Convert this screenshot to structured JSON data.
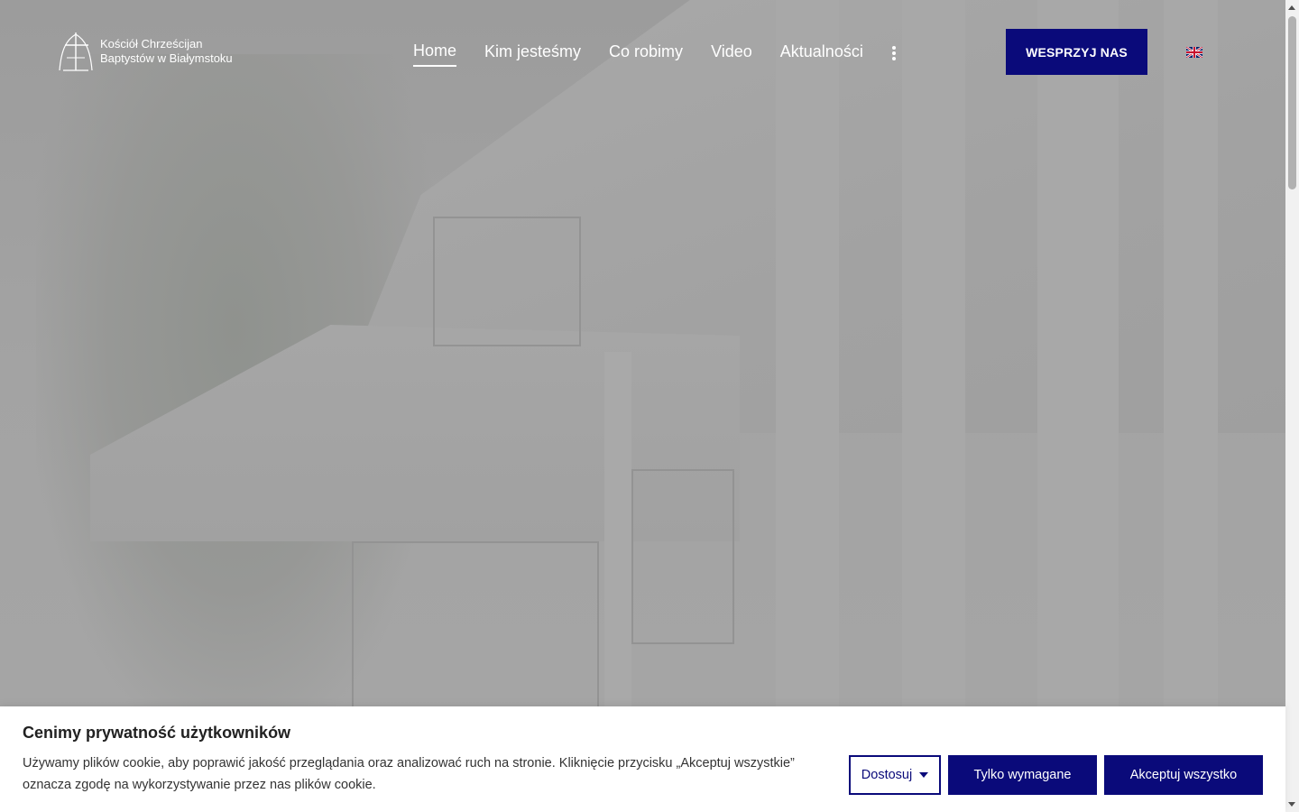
{
  "header": {
    "logo": {
      "line1": "Kościół Chrześcijan",
      "line2": "Baptystów w Białymstoku",
      "icon": "church-cross-logo"
    },
    "nav": [
      {
        "label": "Home",
        "active": true
      },
      {
        "label": "Kim jesteśmy",
        "active": false
      },
      {
        "label": "Co robimy",
        "active": false
      },
      {
        "label": "Video",
        "active": false
      },
      {
        "label": "Aktualności",
        "active": false
      }
    ],
    "more_icon": "vertical-dots-icon",
    "cta_label": "WESPRZYJ NAS",
    "language_icon": "uk-flag-icon"
  },
  "cookie_banner": {
    "title": "Cenimy prywatność użytkowników",
    "text": "Używamy plików cookie, aby poprawić jakość przeglądania oraz analizować ruch na stronie. Kliknięcie przycisku „Akceptuj wszystkie” oznacza zgodę na wykorzystywanie przez nas plików cookie.",
    "customize_label": "Dostosuj",
    "required_only_label": "Tylko wymagane",
    "accept_all_label": "Akceptuj wszystko"
  },
  "colors": {
    "brand": "#0a0a7a",
    "nav_text": "#ffffff",
    "overlay": "#9c9c9c"
  }
}
